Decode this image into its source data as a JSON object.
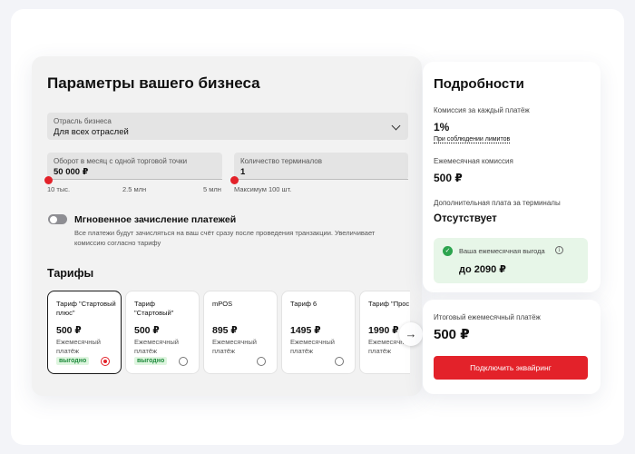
{
  "main": {
    "title": "Параметры вашего бизнеса",
    "industry": {
      "label": "Отрасль бизнеса",
      "value": "Для всех отраслей"
    },
    "turnover": {
      "label": "Оборот в месяц с одной торговой точки",
      "value": "50 000 ₽",
      "ticks": [
        "10 тыс.",
        "2.5 млн",
        "5 млн"
      ]
    },
    "terminals": {
      "label": "Количество терминалов",
      "value": "1",
      "hint": "Максимум 100 шт."
    },
    "instant": {
      "title": "Мгновенное зачисление платежей",
      "description": "Все платежи будут зачисляться на ваш счёт сразу после проведения транзакции. Увеличивает комиссию согласно тарифу",
      "enabled": false
    },
    "tariffs_title": "Тарифы",
    "tariffs": [
      {
        "name": "Тариф \"Стартовый плюс\"",
        "price": "500 ₽",
        "per": "Ежемесячный платёж",
        "badge": "выгодно",
        "selected": true
      },
      {
        "name": "Тариф \"Стартовый\"",
        "price": "500 ₽",
        "per": "Ежемесячный платёж",
        "badge": "выгодно",
        "selected": false
      },
      {
        "name": "mPOS",
        "price": "895 ₽",
        "per": "Ежемесячный платёж",
        "badge": "",
        "selected": false
      },
      {
        "name": "Тариф 6",
        "price": "1495 ₽",
        "per": "Ежемесячный платёж",
        "badge": "",
        "selected": false
      },
      {
        "name": "Тариф \"Прос",
        "price": "1990 ₽",
        "per": "Ежемесячный платёж",
        "badge": "",
        "selected": false
      }
    ],
    "next_arrow": "→"
  },
  "details": {
    "title": "Подробности",
    "commission_label": "Комиссия за каждый платёж",
    "commission_value": "1%",
    "commission_link": "При соблюдении лимитов",
    "monthly_fee_label": "Ежемесячная комиссия",
    "monthly_fee_value": "500 ₽",
    "terminal_fee_label": "Дополнительная плата за терминалы",
    "terminal_fee_value": "Отсутствует",
    "benefit_label": "Ваша ежемесячная выгода",
    "benefit_value": "до 2090 ₽",
    "info_glyph": "i",
    "check_glyph": "✓"
  },
  "summary": {
    "total_label": "Итоговый ежемесячный платёж",
    "total_value": "500 ₽",
    "cta_label": "Подключить эквайринг"
  },
  "colors": {
    "accent": "#e3222a",
    "success": "#2ca44e",
    "success_bg": "#e7f6e8"
  }
}
